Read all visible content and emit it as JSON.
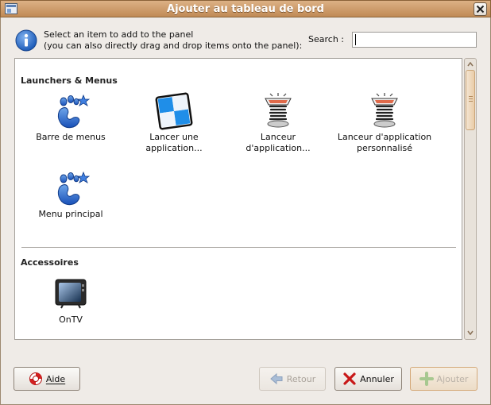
{
  "window": {
    "title": "Ajouter au tableau de bord"
  },
  "header": {
    "hint_line1": "Select an item to add to the panel",
    "hint_line2": "(you can also directly drag and drop items onto the panel):",
    "search_label": "Search :",
    "search_value": ""
  },
  "sections": [
    {
      "title": "Launchers & Menus",
      "items": [
        {
          "line1": "Barre de menus",
          "line2": "",
          "icon": "gnome-foot-icon"
        },
        {
          "line1": "Lancer une",
          "line2": "application...",
          "icon": "run-application-icon"
        },
        {
          "line1": "Lanceur",
          "line2": "d'application...",
          "icon": "launcher-spring-icon"
        },
        {
          "line1": "Lanceur d'application",
          "line2": "personnalisé",
          "icon": "launcher-spring-icon"
        },
        {
          "line1": "Menu principal",
          "line2": "",
          "icon": "gnome-foot-icon"
        }
      ]
    },
    {
      "title": "Accessoires",
      "items": [
        {
          "line1": "OnTV",
          "line2": "",
          "icon": "tv-icon"
        }
      ]
    }
  ],
  "buttons": {
    "help": "Aide",
    "back": "Retour",
    "cancel": "Annuler",
    "add": "Ajouter"
  },
  "colors": {
    "titlebar": "#c99563",
    "window_bg": "#efebe7",
    "accent_blue": "#1f6fd1"
  }
}
